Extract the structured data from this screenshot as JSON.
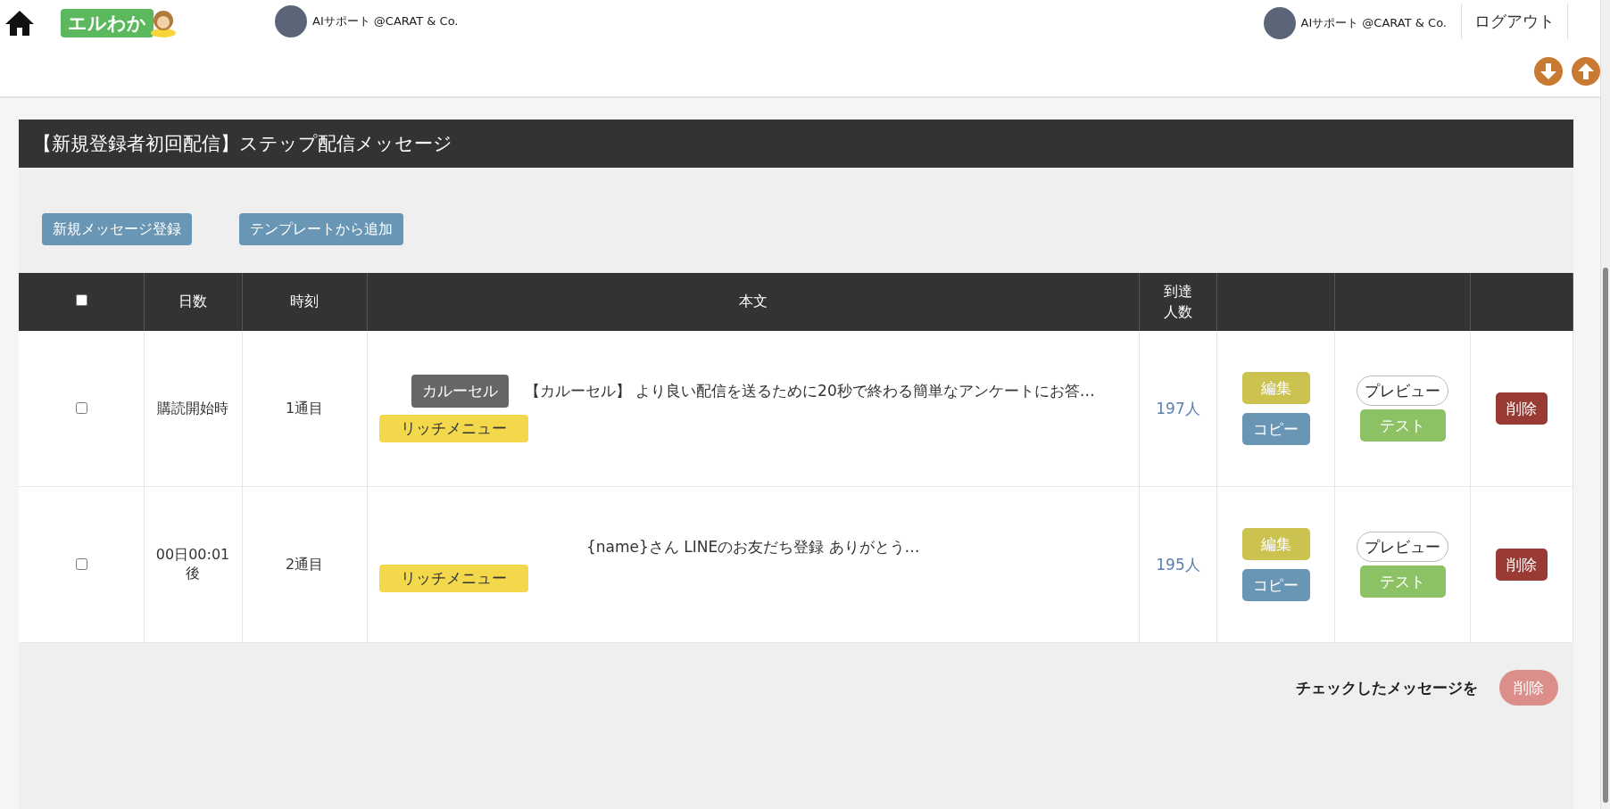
{
  "header": {
    "logo_text": "エルわか",
    "account_left": "AIサポート @CARAT & Co.",
    "account_right": "AIサポート @CARAT & Co.",
    "logout": "ログアウト"
  },
  "panel": {
    "title": "【新規登録者初回配信】ステップ配信メッセージ",
    "actions": [
      "新規メッセージ登録",
      "テンプレートから追加"
    ]
  },
  "table": {
    "select_all_checked": false,
    "columns": [
      "日数",
      "時刻",
      "本文",
      "到達人数"
    ],
    "rows": [
      {
        "checked": false,
        "day": "購読開始時",
        "order": "1通目",
        "tags": [
          {
            "kind": "carousel",
            "label": "カルーセル"
          },
          {
            "kind": "richmenu",
            "label": "リッチメニュー"
          }
        ],
        "text": "【カルーセル】 より良い配信を送るために20秒で終わる簡単なアンケートにお答…",
        "reach": "197人",
        "edit": "編集",
        "copy": "コピー",
        "preview": "プレビュー",
        "test": "テスト",
        "delete": "削除"
      },
      {
        "checked": false,
        "day": "00日00:01\n後",
        "order": "2通目",
        "tags": [
          {
            "kind": "richmenu",
            "label": "リッチメニュー"
          }
        ],
        "text": "{name}さん LINEのお友だち登録 ありがとう…",
        "reach": "195人",
        "edit": "編集",
        "copy": "コピー",
        "preview": "プレビュー",
        "test": "テスト",
        "delete": "削除"
      }
    ]
  },
  "footer": {
    "label": "チェックしたメッセージを",
    "delete": "削除",
    "delete_disabled": true
  }
}
